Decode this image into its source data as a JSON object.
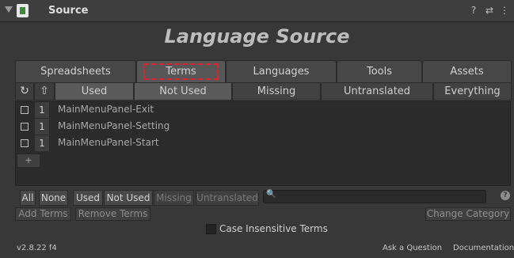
{
  "header": {
    "title": "Source"
  },
  "main": {
    "title": "Language Source"
  },
  "tabs": [
    {
      "label": "Spreadsheets"
    },
    {
      "label": "Terms",
      "active": true
    },
    {
      "label": "Languages"
    },
    {
      "label": "Tools"
    },
    {
      "label": "Assets"
    }
  ],
  "filters": {
    "refresh_icon": "refresh-icon",
    "sort_icon": "up-arrow-icon",
    "items": [
      {
        "label": "Used",
        "active": true
      },
      {
        "label": "Not Used",
        "active": true
      },
      {
        "label": "Missing"
      },
      {
        "label": "Untranslated"
      },
      {
        "label": "Everything"
      }
    ]
  },
  "terms": [
    {
      "count": "1",
      "name": "MainMenuPanel-Exit"
    },
    {
      "count": "1",
      "name": "MainMenuPanel-Setting"
    },
    {
      "count": "1",
      "name": "MainMenuPanel-Start"
    }
  ],
  "add_label": "+",
  "bottom_bar": {
    "all": "All",
    "none": "None",
    "used": "Used",
    "not_used": "Not Used",
    "missing": "Missing",
    "untranslated": "Untranslated",
    "search_value": ""
  },
  "actions": {
    "add_terms": "Add Terms",
    "remove_terms": "Remove Terms",
    "change_category": "Change Category"
  },
  "case_insensitive": {
    "label": "Case Insensitive Terms",
    "checked": false
  },
  "footer": {
    "version": "v2.8.22 f4",
    "ask": "Ask a Question",
    "docs": "Documentation"
  }
}
